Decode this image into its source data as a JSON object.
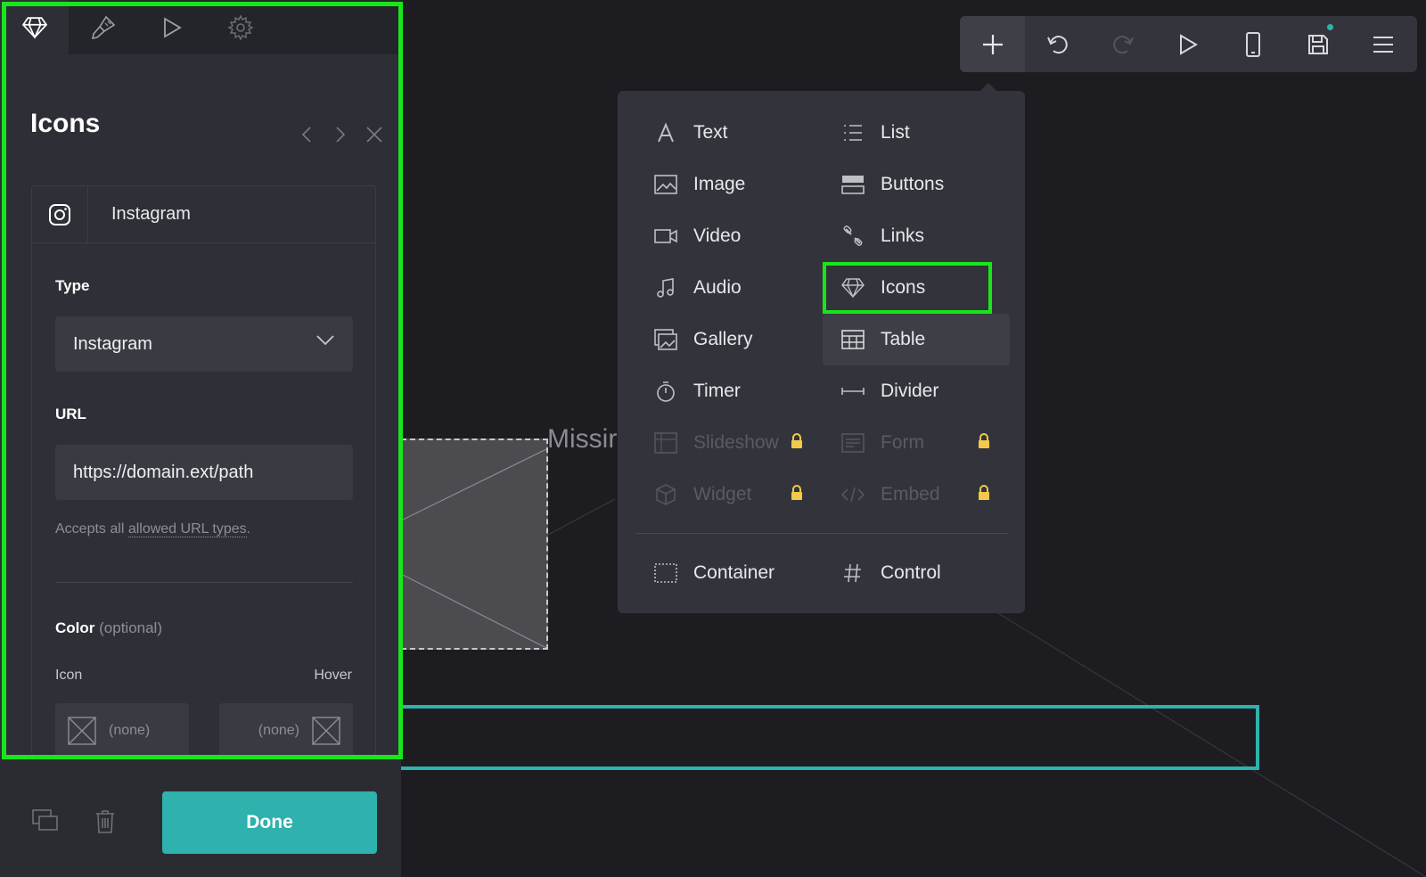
{
  "toolbar": {
    "buttons": [
      {
        "name": "add",
        "icon": "plus-icon"
      },
      {
        "name": "undo",
        "icon": "undo-icon"
      },
      {
        "name": "redo",
        "icon": "redo-icon"
      },
      {
        "name": "preview",
        "icon": "play-icon"
      },
      {
        "name": "mobile",
        "icon": "phone-icon"
      },
      {
        "name": "save",
        "icon": "save-icon"
      },
      {
        "name": "menu",
        "icon": "hamburger-icon"
      }
    ]
  },
  "canvas": {
    "missing_text": "Missir",
    "accent_color": "#2fb1ad"
  },
  "add_menu": {
    "items": {
      "text": "Text",
      "list": "List",
      "image": "Image",
      "buttons": "Buttons",
      "video": "Video",
      "links": "Links",
      "audio": "Audio",
      "icons": "Icons",
      "gallery": "Gallery",
      "table": "Table",
      "timer": "Timer",
      "divider": "Divider",
      "slideshow": "Slideshow",
      "form": "Form",
      "widget": "Widget",
      "embed": "Embed",
      "container": "Container",
      "control": "Control"
    },
    "highlight_color": "#18e61a",
    "lock_color": "#f2c94c"
  },
  "left_panel": {
    "tabs": [
      {
        "icon": "gem-icon"
      },
      {
        "icon": "brush-icon"
      },
      {
        "icon": "play-icon"
      },
      {
        "icon": "gear-icon"
      }
    ],
    "title": "Icons",
    "item": {
      "icon": "instagram-icon",
      "label": "Instagram"
    },
    "type": {
      "label": "Type",
      "value": "Instagram"
    },
    "url": {
      "label": "URL",
      "value": "https://domain.ext/path",
      "help_prefix": "Accepts all ",
      "help_link": "allowed URL types",
      "help_suffix": "."
    },
    "color": {
      "label": "Color",
      "optional": "(optional)",
      "icon_label": "Icon",
      "hover_label": "Hover",
      "icon_value": "(none)",
      "hover_value": "(none)"
    },
    "done_label": "Done"
  }
}
